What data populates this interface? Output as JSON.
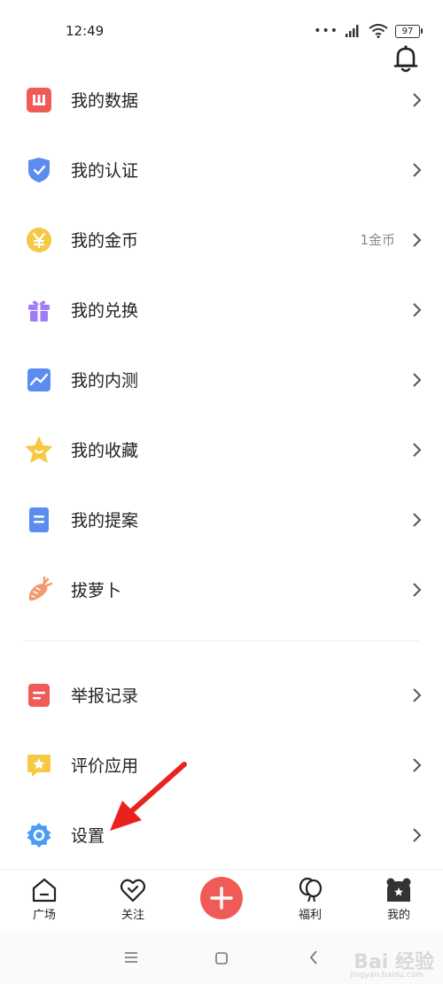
{
  "status_bar": {
    "time": "12:49",
    "battery": "97"
  },
  "menu": {
    "items": [
      {
        "label": "我的数据",
        "icon": "data-chart-icon",
        "color": "#f05a57"
      },
      {
        "label": "我的认证",
        "icon": "shield-check-icon",
        "color": "#5b8df0"
      },
      {
        "label": "我的金币",
        "icon": "yuan-coin-icon",
        "color": "#f7c843",
        "extra": "1金币"
      },
      {
        "label": "我的兑换",
        "icon": "gift-icon",
        "color": "#a27cf5"
      },
      {
        "label": "我的内测",
        "icon": "trend-chart-icon",
        "color": "#5b8df0"
      },
      {
        "label": "我的收藏",
        "icon": "star-icon",
        "color": "#f7c843"
      },
      {
        "label": "我的提案",
        "icon": "document-icon",
        "color": "#5b8df0"
      },
      {
        "label": "拔萝卜",
        "icon": "carrot-icon",
        "color": "#f29a6b"
      },
      {
        "label": "举报记录",
        "icon": "report-icon",
        "color": "#f05a57"
      },
      {
        "label": "评价应用",
        "icon": "rate-icon",
        "color": "#f7c843"
      },
      {
        "label": "设置",
        "icon": "settings-icon",
        "color": "#4b9bf5"
      }
    ]
  },
  "bottom_nav": {
    "items": [
      {
        "label": "广场",
        "icon": "home-icon"
      },
      {
        "label": "关注",
        "icon": "heart-icon"
      },
      {
        "label": "福利",
        "icon": "balloon-icon"
      },
      {
        "label": "我的",
        "icon": "bear-icon"
      }
    ],
    "publish_icon": "plus-icon",
    "publish_color": "#f05a57"
  },
  "watermark": {
    "text": "Bai 经验",
    "sub": "jingyan.baidu.com"
  }
}
